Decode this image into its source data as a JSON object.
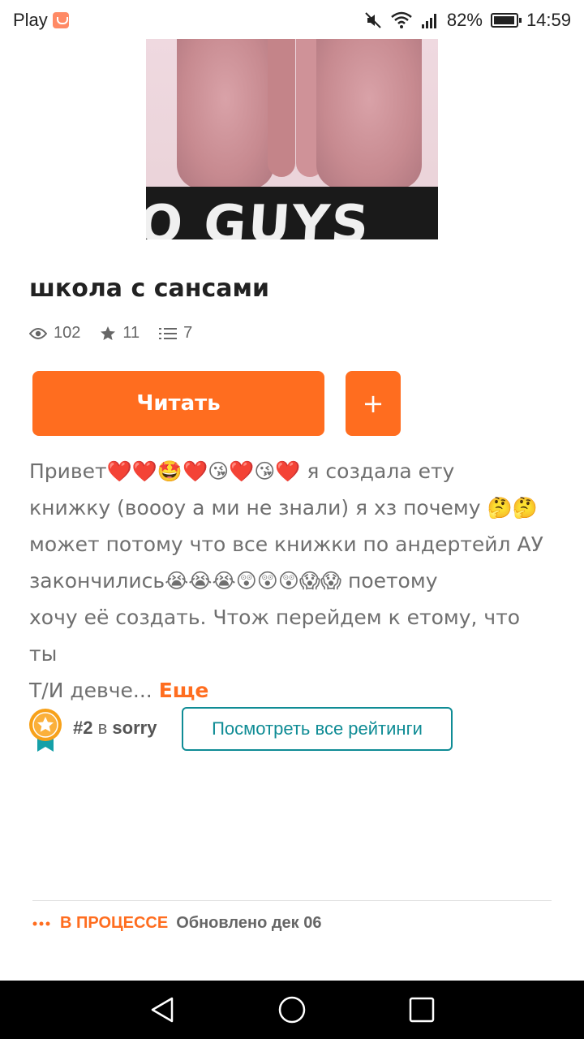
{
  "status_bar": {
    "app_name": "Play",
    "battery": "82%",
    "time": "14:59"
  },
  "cover": {
    "text": "O GUYS CL"
  },
  "story": {
    "title": "школа с сансами",
    "reads": "102",
    "votes": "11",
    "parts": "7"
  },
  "actions": {
    "read_label": "Читать",
    "add_label": "+"
  },
  "description": {
    "lines": [
      "Привет❤️❤️🤩❤️😘❤️😘❤️ я создала ету",
      "книжку (воооу а ми не знали) я хз почему 🤔🤔",
      "может потому что все книжки по андертейл АУ",
      "закончились😭😭😭😲😲😲😱😱 поетому",
      "хочу её создать. Чтож перейдем к етому, что ты",
      "Т/И девче..."
    ],
    "more_label": "Еще"
  },
  "ranking": {
    "rank": "#2",
    "in": "в",
    "tag": "sorry",
    "all_ratings_label": "Посмотреть все рейтинги"
  },
  "footer": {
    "status": "В ПРОЦЕССЕ",
    "updated": "Обновлено дек 06"
  },
  "colors": {
    "accent": "#ff6d1f",
    "teal": "#0f8c95"
  }
}
